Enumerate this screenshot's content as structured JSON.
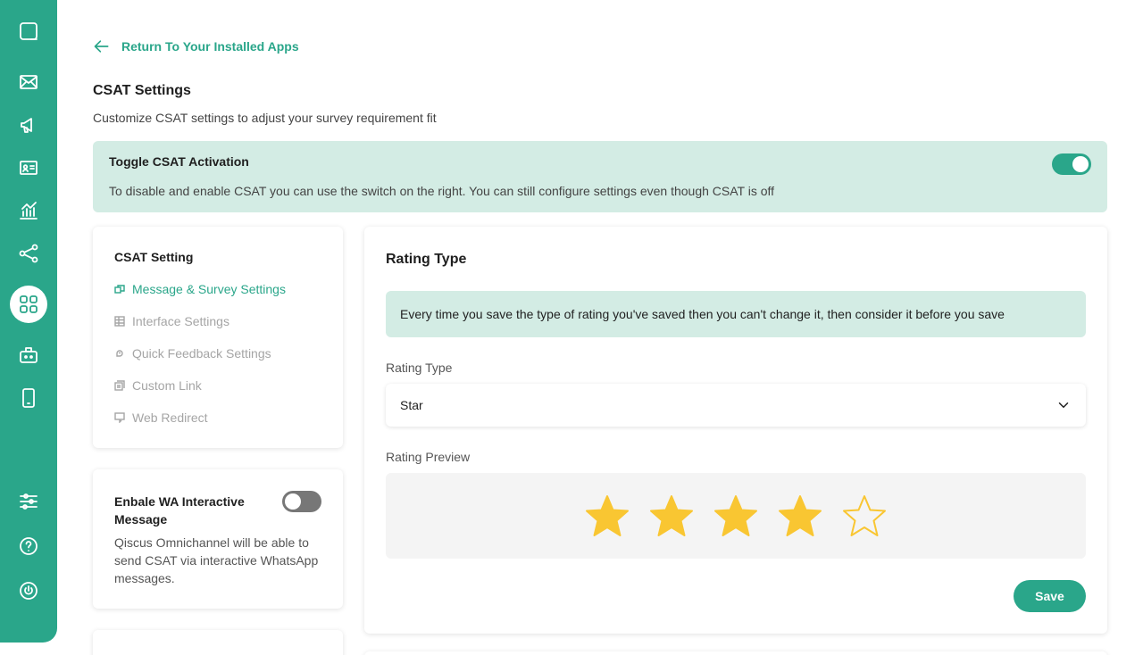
{
  "nav": {
    "back_label": "Return To Your Installed Apps"
  },
  "page": {
    "title": "CSAT Settings",
    "subtitle": "Customize CSAT settings to adjust your survey requirement fit"
  },
  "toggle_banner": {
    "title": "Toggle CSAT Activation",
    "description": "To disable and enable CSAT you can use the switch on the right. You can still configure settings even though CSAT is off",
    "enabled": true
  },
  "settings_menu": {
    "title": "CSAT Setting",
    "items": [
      {
        "label": "Message & Survey Settings",
        "icon": "message-icon",
        "active": true
      },
      {
        "label": "Interface Settings",
        "icon": "table-icon",
        "active": false
      },
      {
        "label": "Quick Feedback Settings",
        "icon": "feedback-icon",
        "active": false
      },
      {
        "label": "Custom Link",
        "icon": "link-icon",
        "active": false
      },
      {
        "label": "Web Redirect",
        "icon": "redirect-icon",
        "active": false
      }
    ]
  },
  "wa_card": {
    "title": "Enbale WA Interactive Message",
    "description": "Qiscus Omnichannel will be able to send CSAT via interactive WhatsApp messages.",
    "enabled": false
  },
  "rating": {
    "section_title": "Rating Type",
    "info": "Every time you save the type of rating you've saved then you can't change it, then consider it before you save",
    "type_label": "Rating Type",
    "type_value": "Star",
    "preview_label": "Rating Preview",
    "stars_filled": 4,
    "stars_total": 5,
    "save_label": "Save"
  },
  "colors": {
    "brand": "#2aa68a",
    "banner_bg": "#d3ece4",
    "star_fill": "#f9c632"
  }
}
